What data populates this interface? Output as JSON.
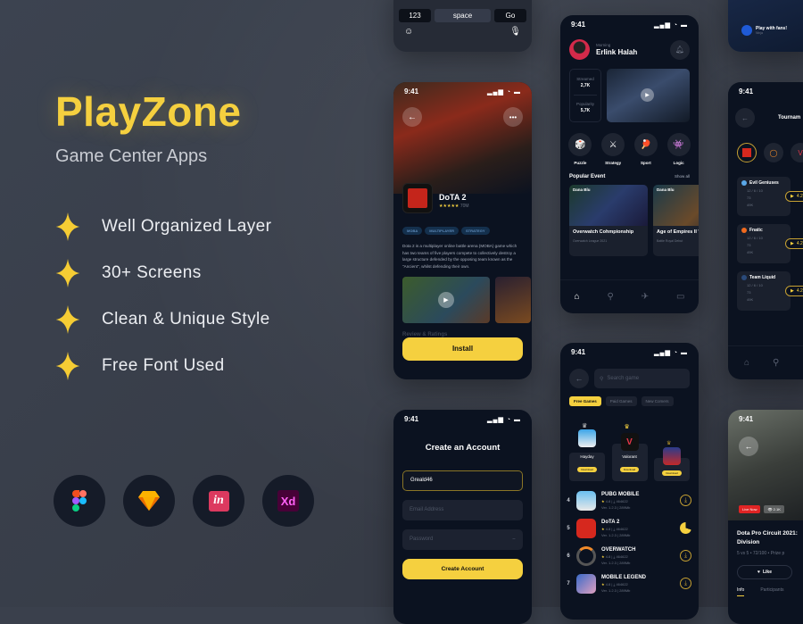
{
  "hero": {
    "brand": "PlayZone",
    "subtitle": "Game Center Apps",
    "features": [
      "Well Organized Layer",
      "30+ Screens",
      "Clean & Unique Style",
      "Free Font Used"
    ],
    "tools": [
      {
        "name": "figma-icon",
        "label": "Figma"
      },
      {
        "name": "sketch-icon",
        "label": "Sketch"
      },
      {
        "name": "invision-icon",
        "label": "in"
      },
      {
        "name": "xd-icon",
        "label": "Xd"
      }
    ]
  },
  "colors": {
    "accent": "#f5d03f",
    "background": "#3a404c",
    "phone": "#0b1220"
  },
  "keyboard": {
    "key_123": "123",
    "space": "space",
    "go": "Go"
  },
  "detail": {
    "time": "9:41",
    "game_title": "DoTA 2",
    "stars": "★★★★★",
    "downloads": "70M",
    "tags": [
      "MOBA",
      "MULTIPLAYER",
      "STRATEGY"
    ],
    "description": "Dota 2 is a multiplayer online battle arena (MOBA) game which has two teams of five players compete to collectively destroy a large structure defended by the opposing team known as the \"Ancient\", whilst defending their own.",
    "review_label": "Review & Ratings",
    "install_label": "Install"
  },
  "signup": {
    "time": "9:41",
    "title": "Create an Account",
    "username_value": "Greald46",
    "email_placeholder": "Email Address",
    "password_placeholder": "Password",
    "submit_label": "Create Account"
  },
  "home": {
    "time": "9:41",
    "greeting": "Morning",
    "user_name": "Erlink Halah",
    "stats": [
      {
        "label": "Streamed",
        "value": "2,7K"
      },
      {
        "label": "Popularity",
        "value": "5,7K"
      }
    ],
    "categories": [
      {
        "label": "Puzzle",
        "icon": "🎲"
      },
      {
        "label": "Strategy",
        "icon": "⚔"
      },
      {
        "label": "Sport",
        "icon": "🏓"
      },
      {
        "label": "Logic",
        "icon": "👾"
      }
    ],
    "popular_title": "Popular Event",
    "show_all": "Show all",
    "events": [
      {
        "host": "Dana Blu",
        "title": "Overwatch Cohmpionship",
        "sub": "Overwatch League 2021"
      },
      {
        "host": "Dana Blu",
        "title": "Age of Empires II World Cup",
        "sub": "Battle Royal Debut"
      }
    ]
  },
  "search": {
    "time": "9:41",
    "placeholder": "Search game",
    "filters": [
      "Free Games",
      "Paid Games",
      "New Comers"
    ],
    "top3": [
      {
        "name": "Hayday",
        "button": "Download"
      },
      {
        "name": "Valorant",
        "button": "Download"
      },
      {
        "name": "",
        "button": "Download"
      }
    ],
    "list": [
      {
        "rank": "4",
        "name": "PUBG MOBILE",
        "rating": "4.8",
        "downloads": "464622",
        "version": "Ver. 1.2.3",
        "size": "289Mb"
      },
      {
        "rank": "5",
        "name": "DoTA 2",
        "rating": "4.8",
        "downloads": "464622",
        "version": "Ver. 1.2.3",
        "size": "289Mb"
      },
      {
        "rank": "6",
        "name": "OVERWATCH",
        "rating": "4.8",
        "downloads": "464622",
        "version": "Ver. 1.2.3",
        "size": "289Mb"
      },
      {
        "rank": "7",
        "name": "MOBILE LEGEND",
        "rating": "4.8",
        "downloads": "464622",
        "version": "Ver. 1.2.3",
        "size": "289Mb"
      }
    ]
  },
  "promo": {
    "title": "Play with fans!",
    "user": "Ninja"
  },
  "tournament": {
    "time": "9:41",
    "title": "Tournam",
    "teams": [
      {
        "name": "Evil Geniuses",
        "kda": "12 / 6 / 10",
        "trophies": "73",
        "earnings": "49K",
        "rating": "4.2"
      },
      {
        "name": "Fnatic",
        "kda": "12 / 6 / 10",
        "trophies": "73",
        "earnings": "49K",
        "rating": "4.2"
      },
      {
        "name": "Team Liquid",
        "kda": "12 / 6 / 10",
        "trophies": "73",
        "earnings": "49K",
        "rating": "4.2"
      }
    ]
  },
  "live": {
    "time": "9:41",
    "live_label": "Live Now",
    "viewers": "2.1K",
    "title": "Dota Pro Circuit 2021: Division",
    "meta": "5 vs 5  •  72/100  •  Prize p",
    "like_label": "Like",
    "tabs": [
      "Info",
      "Participants"
    ]
  }
}
